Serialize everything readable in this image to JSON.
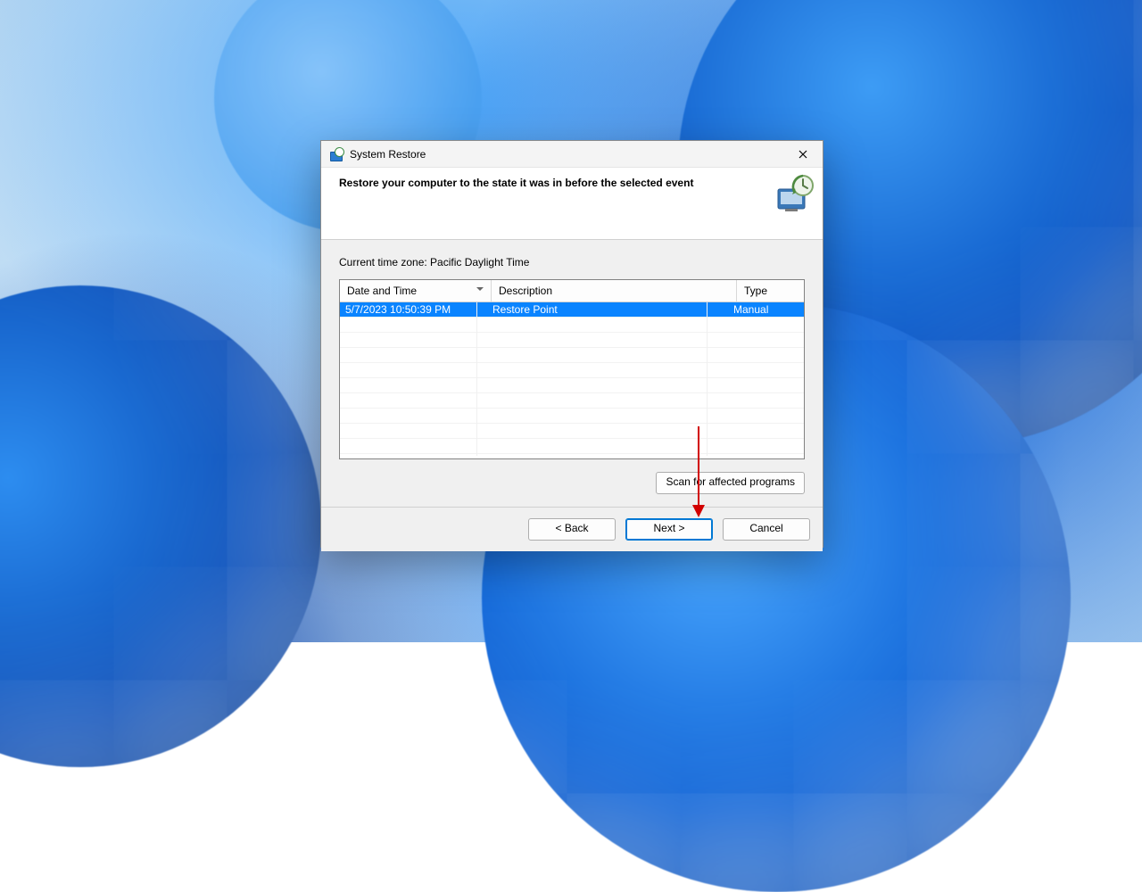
{
  "window": {
    "title": "System Restore",
    "heading": "Restore your computer to the state it was in before the selected event"
  },
  "timezone_label": "Current time zone: Pacific Daylight Time",
  "table": {
    "headers": {
      "date": "Date and Time",
      "desc": "Description",
      "type": "Type"
    },
    "rows": [
      {
        "date": "5/7/2023 10:50:39 PM",
        "desc": "Restore Point",
        "type": "Manual"
      }
    ]
  },
  "buttons": {
    "scan": "Scan for affected programs",
    "back": "< Back",
    "next": "Next >",
    "cancel": "Cancel"
  }
}
